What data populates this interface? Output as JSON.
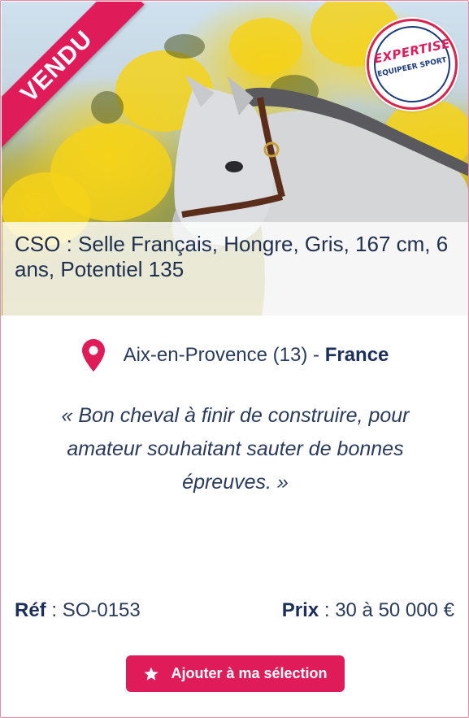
{
  "listing": {
    "status_badge": "VENDU",
    "seal": {
      "line1": "EXPERTISE",
      "line2": "EQUIPEER SPORT"
    },
    "title": "CSO : Selle Français, Hongre, Gris, 167 cm, 6 ans, Potentiel 135",
    "location": {
      "city": "Aix-en-Provence (13)",
      "separator": " - ",
      "country": "France"
    },
    "quote": "« Bon cheval à finir de construire, pour amateur souhaitant sauter de bonnes épreuves. »",
    "reference": {
      "label": "Réf",
      "separator": " : ",
      "value": "SO-0153"
    },
    "price": {
      "label": "Prix",
      "separator": " : ",
      "value": "30 à 50 000 €"
    },
    "add_button_label": "Ajouter à ma sélection"
  },
  "colors": {
    "accent": "#e01b5a",
    "text": "#1f2f4d",
    "border": "#e88aa6",
    "seal_blue": "#1b3a7a"
  },
  "icons": [
    "location-pin-icon",
    "star-icon"
  ]
}
